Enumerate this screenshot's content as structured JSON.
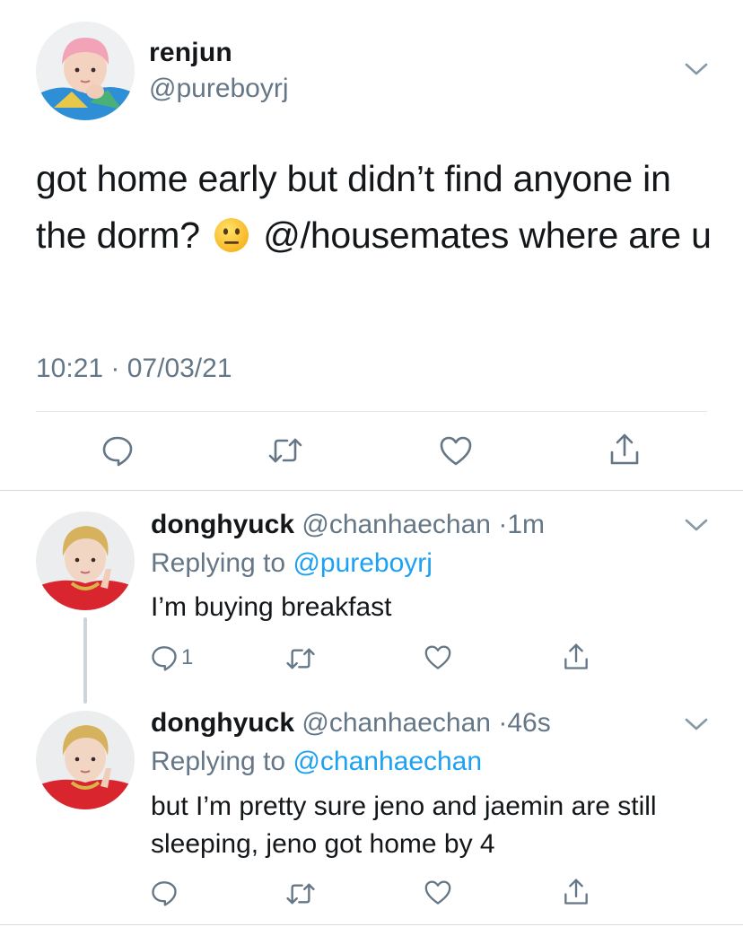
{
  "main_tweet": {
    "name": "renjun",
    "handle": "@pureboyrj",
    "text_part1": "got home early but didn’t find anyone in the dorm?",
    "emoji": "neutral-face-emoji",
    "text_part2": "@/housemates where are u",
    "timestamp": "10:21 · 07/03/21"
  },
  "replies": [
    {
      "name": "donghyuck",
      "handle": "@chanhaechan",
      "separator": "·",
      "time": "1m",
      "replying_prefix": "Replying to ",
      "replying_to": "@pureboyrj",
      "text": "I’m buying breakfast",
      "reply_count": "1"
    },
    {
      "name": "donghyuck",
      "handle": "@chanhaechan",
      "separator": "·",
      "time": "46s",
      "replying_prefix": "Replying to ",
      "replying_to": "@chanhaechan",
      "text": "but I’m pretty sure jeno and jaemin are still sleeping, jeno got home by 4",
      "reply_count": ""
    }
  ],
  "icons": [
    "chevron-down-icon",
    "reply-icon",
    "retweet-icon",
    "like-icon",
    "share-icon"
  ],
  "colors": {
    "text": "#14171a",
    "secondary": "#657786",
    "link": "#1da1f2",
    "divider": "#e1e8ed"
  }
}
